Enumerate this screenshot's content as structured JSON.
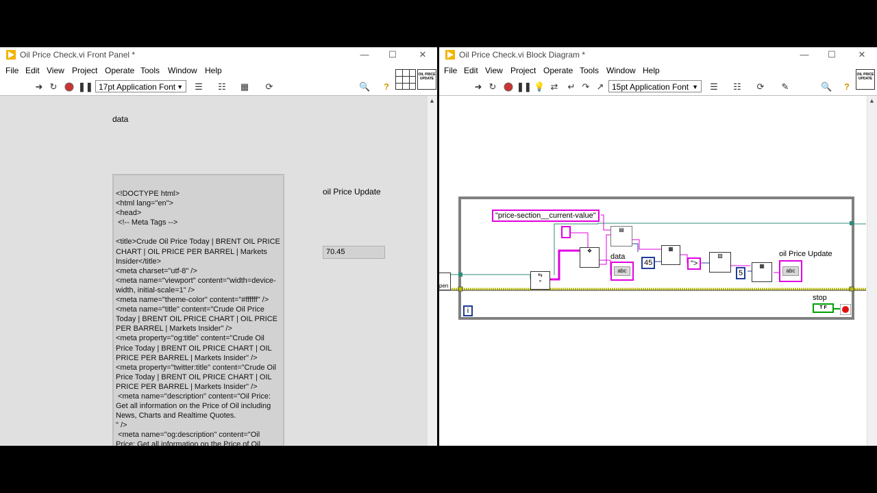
{
  "front_panel": {
    "title": "Oil Price Check.vi Front Panel *",
    "menu": [
      "File",
      "Edit",
      "View",
      "Project",
      "Operate",
      "Tools",
      "Window",
      "Help"
    ],
    "font": "17pt Application Font",
    "badge": "OIL PRICE UPDATE",
    "data_label": "data",
    "data_value": "<!DOCTYPE html>\n<html lang=\"en\">\n<head>\n <!-- Meta Tags -->\n\n<title>Crude Oil Price Today | BRENT OIL PRICE CHART | OIL PRICE PER BARREL | Markets Insider</title>\n<meta charset=\"utf-8\" />\n<meta name=\"viewport\" content=\"width=device-width, initial-scale=1\" />\n<meta name=\"theme-color\" content=\"#ffffff\" />\n<meta name=\"title\" content=\"Crude Oil Price Today | BRENT OIL PRICE CHART | OIL PRICE PER BARREL | Markets Insider\" />\n<meta property=\"og:title\" content=\"Crude Oil Price Today | BRENT OIL PRICE CHART | OIL PRICE PER BARREL | Markets Insider\" />\n<meta property=\"twitter:title\" content=\"Crude Oil Price Today | BRENT OIL PRICE CHART | OIL PRICE PER BARREL | Markets Insider\" />\n <meta name=\"description\" content=\"Oil Price: Get all information on the Price of Oil including News, Charts and Realtime Quotes.\n\" />\n <meta name=\"og:description\" content=\"Oil Price: Get all information on the Price of Oil including News, Charts and Realtime Quotes.",
    "price_label": "oil Price Update",
    "price_value": "70.45"
  },
  "block_diagram": {
    "title": "Oil Price Check.vi Block Diagram *",
    "menu": [
      "File",
      "Edit",
      "View",
      "Project",
      "Operate",
      "Tools",
      "Window",
      "Help"
    ],
    "font": "15pt Application Font",
    "badge": "OIL PRICE UPDATE",
    "search_string": "\"price-section__current-value\"",
    "offset_const": "45",
    "delimiter_const": "\">",
    "length_const": "5",
    "data_label": "data",
    "price_label": "oil Price Update",
    "stop_label": "stop",
    "iteration_label": "i",
    "bool_const": "T F",
    "open_label": "pen",
    "terminal_text": "abc"
  },
  "colors": {
    "string_wire": "#e000e0",
    "numeric_wire": "#1f3a9a",
    "error_wire": "#bdbd00",
    "refnum_wire": "#2e8b7a"
  }
}
